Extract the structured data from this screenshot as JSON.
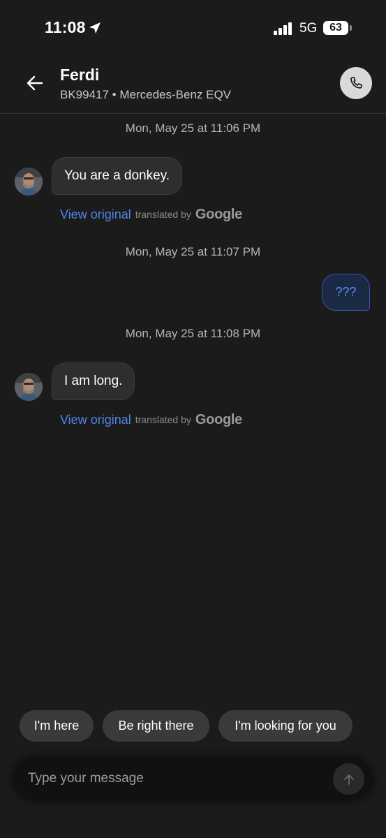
{
  "status_bar": {
    "time": "11:08",
    "network": "5G",
    "battery": "63",
    "icons": [
      "location-arrow-icon",
      "signal-bars-icon",
      "battery-icon"
    ]
  },
  "header": {
    "contact_name": "Ferdi",
    "contact_subtitle": "BK99417 • Mercedes-Benz EQV",
    "icons": [
      "back-arrow-icon",
      "phone-icon"
    ]
  },
  "conversation": {
    "messages": [
      {
        "timestamp": "Mon, May 25 at 11:06 PM",
        "direction": "incoming",
        "text": "You are a donkey.",
        "view_original": "View original",
        "translated_by": "translated by",
        "google": "Google"
      },
      {
        "timestamp": "Mon, May 25 at 11:07 PM",
        "direction": "outgoing",
        "text": "???"
      },
      {
        "timestamp": "Mon, May 25 at 11:08 PM",
        "direction": "incoming",
        "text": "I am long.",
        "view_original": "View original",
        "translated_by": "translated by",
        "google": "Google"
      }
    ]
  },
  "quick_replies": [
    "I'm here",
    "Be right there",
    "I'm looking for you"
  ],
  "composer": {
    "placeholder": "Type your message",
    "send_icon": "arrow-up-icon"
  },
  "colors": {
    "background": "#1b1b1c",
    "incoming_bubble": "#2e2e2f",
    "outgoing_bubble_border": "#2f5aa8",
    "link_blue": "#4f86e6"
  }
}
